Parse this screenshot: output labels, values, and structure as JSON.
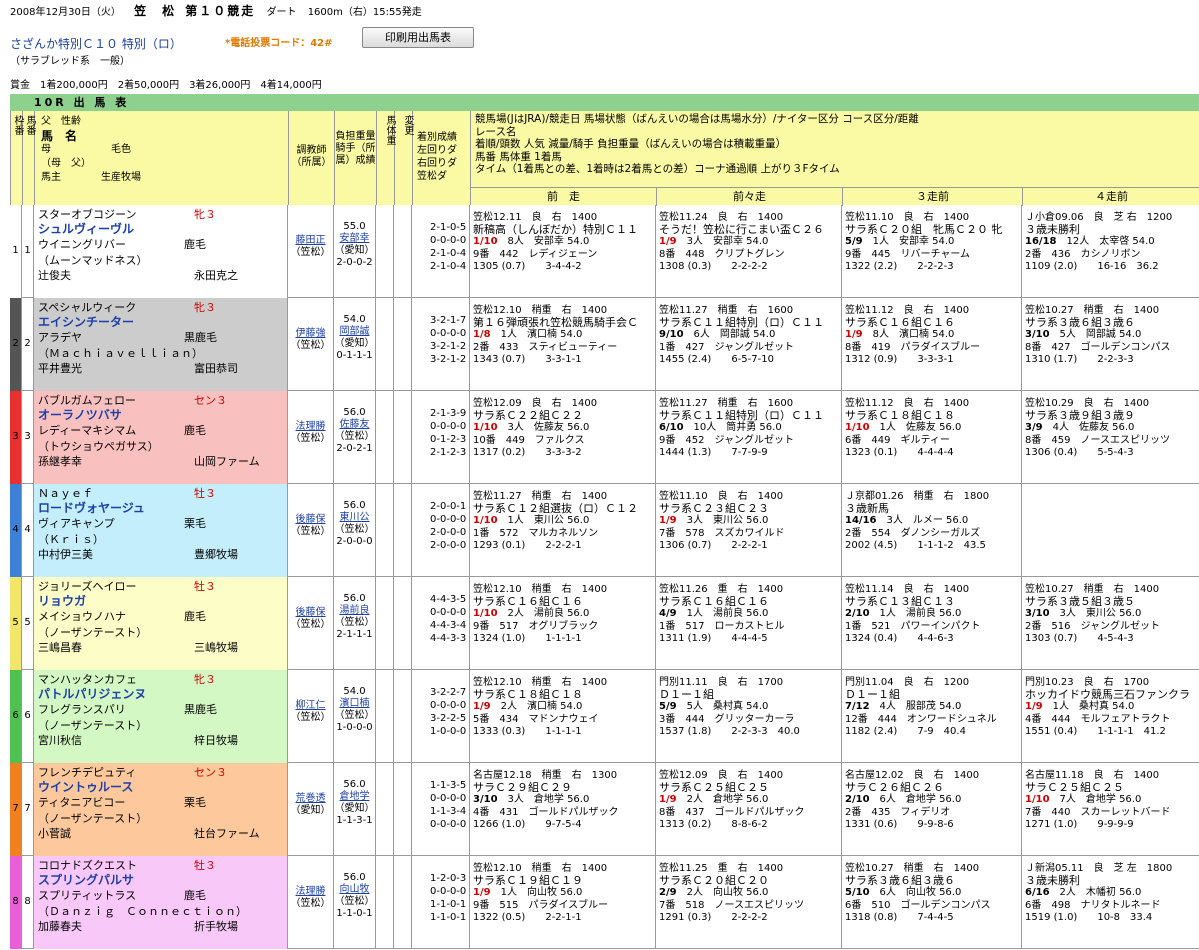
{
  "header": {
    "date": "2008年12月30日（火）",
    "venue": "笠　松",
    "race_no": "第１０競走",
    "surface": "ダート",
    "dist": "1600m（右）15:55発走",
    "race_name": "さざんか特別Ｃ１０ 特別（ロ）",
    "phone": "*電話投票コード：42#",
    "print_button": "印刷用出馬表",
    "sub": "（サラブレッド系　一般）",
    "prize": "賞金　1着200,000円　2着50,000円　3着26,000円　4着14,000円",
    "bar": "10R 出 馬 表"
  },
  "columns": {
    "waku": "枠番",
    "umaban": "馬番",
    "horse_head": [
      "父　性齢",
      "馬　名",
      "母　　　　　　毛色",
      "（母　父）",
      "馬主　　　　生産牧場"
    ],
    "trainer": "調教師（所属）",
    "jockey": "負担重量 騎手（所属）成績",
    "weight": "馬体重",
    "change": "変更",
    "record": "着別成績 左回りダ 右回りダ 笠松ダ",
    "info": [
      "競馬場(JはJRA)/競走日 馬場状態（ばんえいの場合は馬場水分）/ナイター区分 コース区分/距離",
      "レース名",
      "着順/頭数 人気 減量/騎手 負担重量（ばんえいの場合は積載重量）",
      "馬番 馬体重 1着馬",
      "タイム（1着馬との差、1着時は2着馬との差）コーナ通過順 上がり３Fタイム"
    ],
    "past_labels": [
      "前　走",
      "前々走",
      "３走前",
      "４走前"
    ]
  },
  "horses": [
    {
      "waku": "1",
      "num": "1",
      "color": "#ffffff",
      "wakucolor": "#ffffff",
      "sire": "スターオブコジーン",
      "sex": "牝３",
      "name": "シュルヴィーヴル",
      "dam": "ウイニングリバー",
      "coat": "鹿毛",
      "damsire": "（ムーンマッドネス）",
      "owner": "辻俊夫",
      "breeder": "永田克之",
      "trainer": "藤田正",
      "trainer_aff": "（笠松）",
      "weight": "55.0",
      "jockey": "安部幸",
      "jockey_aff": "（愛知）",
      "jrec": "2-0-0-2",
      "rec": [
        "2-1-0-5",
        "0-0-0-0",
        "2-1-0-4",
        "2-1-0-4"
      ],
      "past": [
        [
          "笠松12.11　良　右　1400",
          "新稿高（しんぼだか）特別Ｃ１１",
          "1/10",
          "8人　安部幸 54.0",
          "9番　442　レディジェーン",
          "1305 (0.7)　　3-4-4-2"
        ],
        [
          "笠松11.24　良　右　1400",
          "そうだ！笠松に行こまい盃Ｃ２６",
          "1/9",
          "3人　安部幸 54.0",
          "8番　448　クリプトグレン",
          "1308 (0.3)　　2-2-2-2"
        ],
        [
          "笠松11.10　良　右　1400",
          "サラ系Ｃ２０組　牝馬Ｃ２０ 牝",
          "5/9",
          "1人　安部幸 54.0",
          "9番　445　リバーチャーム",
          "1322 (2.2)　　2-2-2-3"
        ],
        [
          "Ｊ小倉09.06　良　芝 右　1200",
          "３歳未勝利",
          "16/18",
          "12人　太宰啓 54.0",
          "2番　436　カシノリボン",
          "1109 (2.0)　　16-16　36.2"
        ]
      ]
    },
    {
      "waku": "2",
      "num": "2",
      "color": "#cccccc",
      "wakucolor": "#555555",
      "sire": "スペシャルウィーク",
      "sex": "牝３",
      "name": "エイシンチーター",
      "dam": "アラデヤ",
      "coat": "黒鹿毛",
      "damsire": "（Ｍａｃｈｉａｖｅｌｌｉａｎ）",
      "owner": "平井豊光",
      "breeder": "富田恭司",
      "trainer": "伊藤強",
      "trainer_aff": "（笠松）",
      "weight": "54.0",
      "jockey": "岡部誠",
      "jockey_aff": "（愛知）",
      "jrec": "0-1-1-1",
      "rec": [
        "3-2-1-7",
        "0-0-0-0",
        "3-2-1-2",
        "3-2-1-2"
      ],
      "past": [
        [
          "笠松12.10　稍重　右　1400",
          "第１６弾頑張れ笠松競馬騎手会Ｃ",
          "1/8",
          "1人　濱口楠 54.0",
          "2番　433　スティビューティー",
          "1343 (0.7)　　3-3-1-1"
        ],
        [
          "笠松11.27　稍重　右　1600",
          "サラ系Ｃ１１組特別（ロ）Ｃ１１",
          "9/10",
          "6人　岡部誠 54.0",
          "1番　427　ジャングルゼット",
          "1455 (2.4)　　6-5-7-10"
        ],
        [
          "笠松11.12　良　右　1400",
          "サラ系Ｃ１６組Ｃ１６",
          "1/9",
          "8人　濱口楠 54.0",
          "8番　419　パラダイスブルー",
          "1312 (0.9)　　3-3-3-1"
        ],
        [
          "笠松10.27　稍重　右　1400",
          "サラ系３歳６組３歳６",
          "3/10",
          "5人　岡部誠 54.0",
          "8番　427　ゴールデンコンパス",
          "1310 (1.7)　　2-2-3-3"
        ]
      ]
    },
    {
      "waku": "3",
      "num": "3",
      "color": "#f9c0c0",
      "wakucolor": "#e83030",
      "sire": "バブルガムフェロー",
      "sex": "セン３",
      "name": "オーラノツバサ",
      "dam": "レディーマキシマム",
      "coat": "鹿毛",
      "damsire": "（トウショウペガサス）",
      "owner": "孫継孝幸",
      "breeder": "山岡ファーム",
      "trainer": "法理勝",
      "trainer_aff": "（笠松）",
      "weight": "56.0",
      "jockey": "佐藤友",
      "jockey_aff": "（笠松）",
      "jrec": "2-0-2-1",
      "rec": [
        "2-1-3-9",
        "0-0-0-0",
        "0-1-2-3",
        "2-1-2-3"
      ],
      "past": [
        [
          "笠松12.09　良　右　1400",
          "サラ系Ｃ２２組Ｃ２２",
          "1/10",
          "3人　佐藤友 56.0",
          "10番　449　ファルクス",
          "1317 (0.2)　　3-3-3-2"
        ],
        [
          "笠松11.27　稍重　右　1600",
          "サラ系Ｃ１１組特別（ロ）Ｃ１１",
          "6/10",
          "10人　筒井勇 56.0",
          "9番　452　ジャングルゼット",
          "1444 (1.3)　　7-7-9-9"
        ],
        [
          "笠松11.12　良　右　1400",
          "サラ系Ｃ１８組Ｃ１８",
          "1/10",
          "1人　佐藤友 56.0",
          "6番　449　ギルティー",
          "1323 (0.1)　　4-4-4-4"
        ],
        [
          "笠松10.29　良　右　1400",
          "サラ系３歳９組３歳９",
          "3/9",
          "4人　佐藤友 56.0",
          "8番　459　ノースエスピリッツ",
          "1306 (0.4)　　5-5-4-3"
        ]
      ]
    },
    {
      "waku": "4",
      "num": "4",
      "color": "#c4eefc",
      "wakucolor": "#3c80d8",
      "sire": "Ｎａｙｅｆ",
      "sex": "牡３",
      "name": "ロードヴォヤージュ",
      "dam": "ヴィアキャンプ",
      "coat": "栗毛",
      "damsire": "（Ｋｒｉｓ）",
      "owner": "中村伊三美",
      "breeder": "豊郷牧場",
      "trainer": "後藤保",
      "trainer_aff": "（笠松）",
      "weight": "56.0",
      "jockey": "東川公",
      "jockey_aff": "（笠松）",
      "jrec": "2-0-0-0",
      "rec": [
        "2-0-0-1",
        "0-0-0-0",
        "2-0-0-0",
        "2-0-0-0"
      ],
      "past": [
        [
          "笠松11.27　稍重　右　1400",
          "サラ系Ｃ１２組選抜（ロ）Ｃ１２",
          "1/10",
          "1人　東川公 56.0",
          "1番　572　マルカネルソン",
          "1293 (0.1)　　2-2-2-1"
        ],
        [
          "笠松11.10　良　右　1400",
          "サラ系Ｃ２３組Ｃ２３",
          "1/9",
          "3人　東川公 56.0",
          "7番　578　スズカワイルド",
          "1306 (0.7)　　2-2-2-1"
        ],
        [
          "Ｊ京都01.26　稍重　右　1800",
          "３歳新馬",
          "14/16",
          "3人　ルメー 56.0",
          "2番　554　ダノンシーガルズ",
          "2002 (4.5)　　1-1-1-2　43.5"
        ],
        [
          "",
          "",
          "",
          "",
          "",
          ""
        ]
      ]
    },
    {
      "waku": "5",
      "num": "5",
      "color": "#fdfdc8",
      "wakucolor": "#f2e66a",
      "sire": "ジョリーズヘイロー",
      "sex": "牡３",
      "name": "リョウガ",
      "dam": "メイショウノハナ",
      "coat": "鹿毛",
      "damsire": "（ノーザンテースト）",
      "owner": "三嶋昌春",
      "breeder": "三嶋牧場",
      "trainer": "後藤保",
      "trainer_aff": "（笠松）",
      "weight": "56.0",
      "jockey": "湯前良",
      "jockey_aff": "（笠松）",
      "jrec": "2-1-1-1",
      "rec": [
        "4-4-3-5",
        "0-0-0-0",
        "4-4-3-4",
        "4-4-3-3"
      ],
      "past": [
        [
          "笠松12.10　稍重　右　1400",
          "サラ系Ｃ１６組Ｃ１６",
          "1/10",
          "2人　湯前良 56.0",
          "9番　517　オグリブラック",
          "1324 (1.0)　　1-1-1-1"
        ],
        [
          "笠松11.26　重　右　1400",
          "サラ系Ｃ１６組Ｃ１６",
          "4/9",
          "1人　湯前良 56.0",
          "1番　517　ローカストヒル",
          "1311 (1.9)　　4-4-4-5"
        ],
        [
          "笠松11.14　良　右　1400",
          "サラ系Ｃ１３組Ｃ１３",
          "2/10",
          "1人　湯前良 56.0",
          "1番　521　パワーインパクト",
          "1324 (0.4)　　4-4-6-3"
        ],
        [
          "笠松10.27　稍重　右　1400",
          "サラ系３歳５組３歳５",
          "3/10",
          "3人　東川公 56.0",
          "2番　516　ジャングルゼット",
          "1303 (0.7)　　4-5-4-3"
        ]
      ]
    },
    {
      "waku": "6",
      "num": "6",
      "color": "#d4f8c4",
      "wakucolor": "#50c050",
      "sire": "マンハッタンカフェ",
      "sex": "牝３",
      "name": "パトルパリジェンヌ",
      "dam": "フレグランスパリ",
      "coat": "黒鹿毛",
      "damsire": "（ノーザンテースト）",
      "owner": "宮川秋信",
      "breeder": "梓日牧場",
      "trainer": "柳江仁",
      "trainer_aff": "（笠松）",
      "weight": "54.0",
      "jockey": "濱口楠",
      "jockey_aff": "（笠松）",
      "jrec": "1-0-0-0",
      "rec": [
        "3-2-2-7",
        "0-0-0-0",
        "3-2-2-5",
        "1-0-0-0"
      ],
      "past": [
        [
          "笠松12.10　稍重　右　1400",
          "サラ系Ｃ１８組Ｃ１８",
          "1/9",
          "2人　濱口楠 54.0",
          "5番　434　マドンナウェイ",
          "1333 (0.3)　　1-1-1-1"
        ],
        [
          "門別11.11　良　右　1700",
          "Ｄ１ー１組",
          "5/9",
          "5人　桑村真 54.0",
          "3番　444　グリッターカーラ",
          "1537 (1.8)　　2-2-3-3　40.0"
        ],
        [
          "門別11.04　良　右　1200",
          "Ｄ１ー１組",
          "7/12",
          "4人　服部茂 54.0",
          "12番　444　オンワードシュネル",
          "1182 (2.4)　　7-9　40.4"
        ],
        [
          "門別10.23　良　右　1700",
          "ホッカイドウ競馬三石ファンクラ",
          "1/9",
          "1人　桑村真 54.0",
          "4番　444　モルフェアトラクト",
          "1551 (0.4)　　1-1-1-1　41.2"
        ]
      ]
    },
    {
      "waku": "7",
      "num": "7",
      "color": "#fcc89c",
      "wakucolor": "#f08020",
      "sire": "フレンチデピュティ",
      "sex": "セン３",
      "name": "ウイントゥルース",
      "dam": "ティタニアビコー",
      "coat": "栗毛",
      "damsire": "（ノーザンテースト）",
      "owner": "小菅誠",
      "breeder": "社台ファーム",
      "trainer": "荒巻透",
      "trainer_aff": "（愛知）",
      "weight": "56.0",
      "jockey": "倉地学",
      "jockey_aff": "（愛知）",
      "jrec": "1-1-3-1",
      "rec": [
        "1-1-3-5",
        "0-0-0-0",
        "1-1-3-4",
        "0-0-0-0"
      ],
      "past": [
        [
          "名古屋12.18　稍重　右　1300",
          "サラＣ２９組Ｃ２９",
          "3/10",
          "3人　倉地学 56.0",
          "4番　431　ゴールドパルザック",
          "1266 (1.0)　　9-7-5-4"
        ],
        [
          "笠松12.09　良　右　1400",
          "サラ系Ｃ２５組Ｃ２５",
          "1/9",
          "2人　倉地学 56.0",
          "8番　437　ゴールドパルザック",
          "1313 (0.2)　　8-8-6-2"
        ],
        [
          "名古屋12.02　良　右　1400",
          "サラＣ２６組Ｃ２６",
          "2/10",
          "6人　倉地学 56.0",
          "2番　435　フィデリオ",
          "1331 (0.6)　　9-9-8-6"
        ],
        [
          "名古屋11.18　良　右　1400",
          "サラＣ２５組Ｃ２５",
          "1/10",
          "7人　倉地学 56.0",
          "7番　440　スカーレットバード",
          "1271 (1.0)　　9-9-9-9"
        ]
      ]
    },
    {
      "waku": "8",
      "num": "8",
      "color": "#f8c8f8",
      "wakucolor": "#e860d8",
      "sire": "コロナドズクエスト",
      "sex": "牡３",
      "name": "スプリングパルサ",
      "dam": "スプリティットラス",
      "coat": "鹿毛",
      "damsire": "（Ｄａｎｚｉｇ　Ｃｏｎｎｅｃｔｉｏｎ）",
      "owner": "加藤春夫",
      "breeder": "折手牧場",
      "trainer": "法理勝",
      "trainer_aff": "（笠松）",
      "weight": "56.0",
      "jockey": "向山牧",
      "jockey_aff": "（笠松）",
      "jrec": "1-1-0-1",
      "rec": [
        "1-2-0-3",
        "0-0-0-0",
        "1-1-0-1",
        "1-1-0-1"
      ],
      "past": [
        [
          "笠松12.10　稍重　右　1400",
          "サラ系Ｃ１９組Ｃ１９",
          "1/9",
          "1人　向山牧 56.0",
          "9番　515　パラダイスブルー",
          "1322 (0.5)　　2-2-1-1"
        ],
        [
          "笠松11.25　重　右　1400",
          "サラ系Ｃ２０組Ｃ２０",
          "2/9",
          "2人　向山牧 56.0",
          "7番　518　ノースエスピリッツ",
          "1291 (0.3)　　2-2-2-2"
        ],
        [
          "笠松10.27　稍重　右　1400",
          "サラ系３歳６組３歳６",
          "5/10",
          "6人　向山牧 56.0",
          "6番　510　ゴールデンコンパス",
          "1318 (0.8)　　7-4-4-5"
        ],
        [
          "Ｊ新潟05.11　良　芝 左　1800",
          "３歳未勝利",
          "6/16",
          "2人　木幡初 56.0",
          "6番　498　ナリタトルネード",
          "1519 (1.0)　　10-8　33.4"
        ]
      ]
    }
  ]
}
